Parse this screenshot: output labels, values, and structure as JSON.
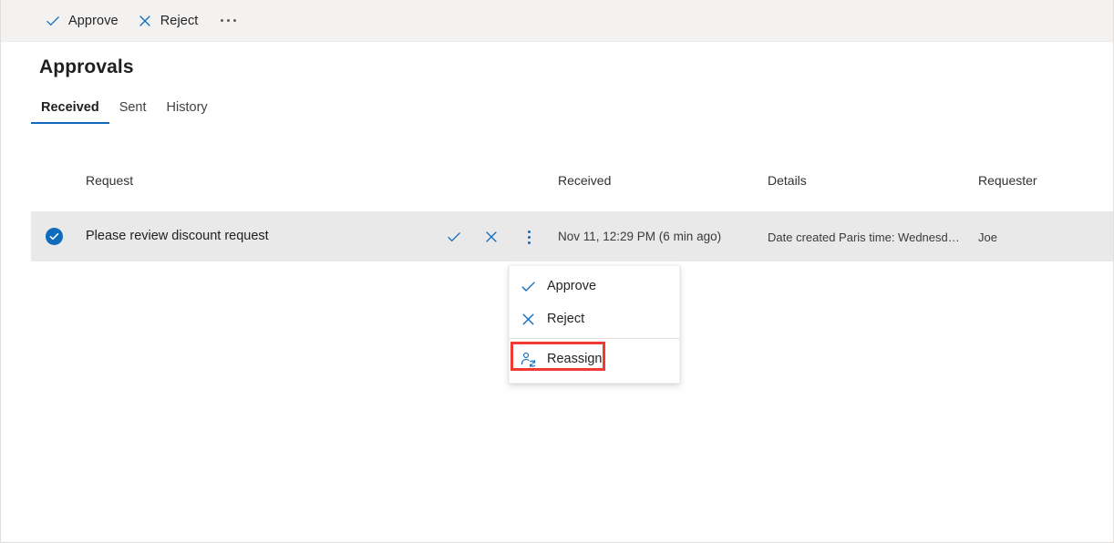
{
  "window": {
    "title": "Approvals"
  },
  "colors": {
    "accent": "#0f6cbd",
    "command_bar_bg": "#f3f2f1",
    "row_selected_bg": "#e9e9e9",
    "highlight_red": "#f03a32",
    "text_primary": "#201f1e",
    "text_secondary": "#3b3a39"
  },
  "command_bar": {
    "items": [
      {
        "label": "Approve",
        "icon": "checkmark-icon"
      },
      {
        "label": "Reject",
        "icon": "dismiss-icon"
      }
    ],
    "overflow": {
      "icon": "more-horizontal-icon",
      "label": "More options"
    }
  },
  "tabs": [
    {
      "label": "Received",
      "selected": true
    },
    {
      "label": "Sent",
      "selected": false
    },
    {
      "label": "History",
      "selected": false
    }
  ],
  "table": {
    "columns": [
      {
        "key": "request",
        "label": "Request"
      },
      {
        "key": "received",
        "label": "Received"
      },
      {
        "key": "details",
        "label": "Details"
      },
      {
        "key": "requester",
        "label": "Requester"
      }
    ],
    "rows": [
      {
        "selected": true,
        "checkbox_icon": "checkbox-checked-circle-icon",
        "request": "Please review discount request",
        "actions": [
          {
            "label": "Approve",
            "icon": "checkmark-icon"
          },
          {
            "label": "Reject",
            "icon": "dismiss-icon"
          },
          {
            "label": "More options",
            "icon": "more-vertical-icon"
          }
        ],
        "received": "Nov 11, 12:29 PM (6 min ago)",
        "details": "Date created Paris time: Wednesday,...",
        "requester": "Joe"
      }
    ]
  },
  "context_menu": {
    "visible": true,
    "items": [
      {
        "label": "Approve",
        "icon": "checkmark-icon",
        "highlighted": false
      },
      {
        "label": "Reject",
        "icon": "dismiss-icon",
        "highlighted": false
      },
      {
        "label": "Reassign",
        "icon": "person-swap-icon",
        "highlighted": true
      }
    ]
  }
}
